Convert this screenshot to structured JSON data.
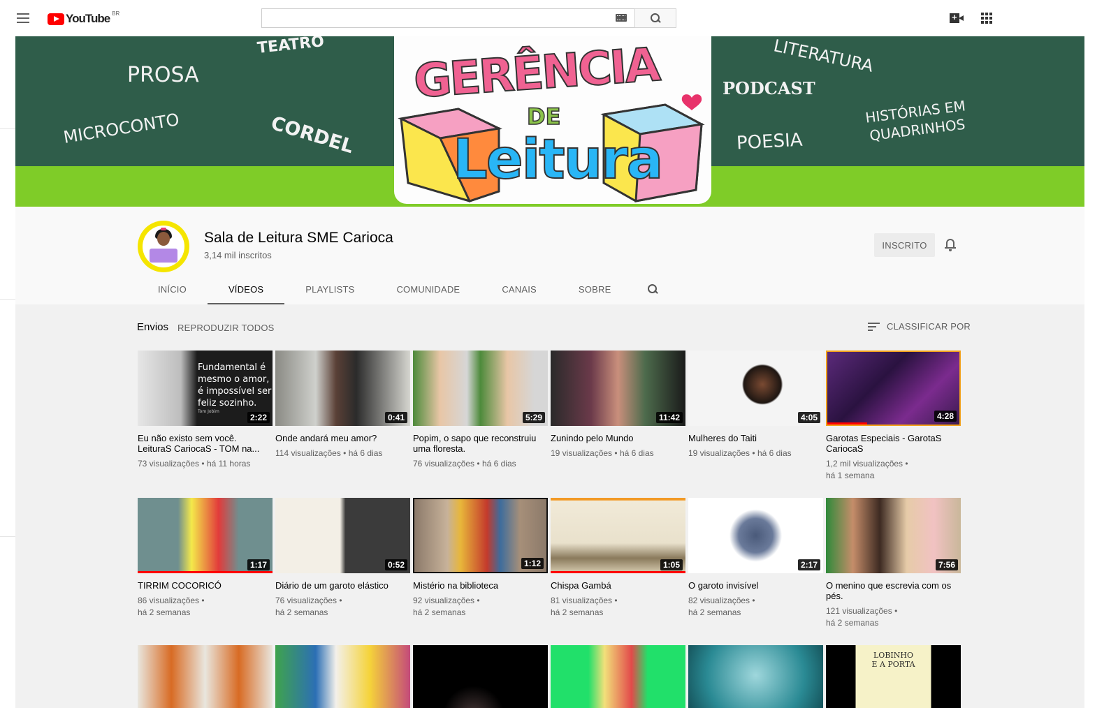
{
  "masthead": {
    "logo_text": "YouTube",
    "country": "BR",
    "search_placeholder": ""
  },
  "banner": {
    "words": [
      "TEATRO",
      "PROSA",
      "MICROCONTO",
      "CORDEL",
      "LITERATURA",
      "PODCAST",
      "POESIA",
      "HISTÓRIAS EM",
      "QUADRINHOS"
    ],
    "logo_line1": "GERÊNCIA",
    "logo_line2": "DE",
    "logo_line3": "Leitura",
    "colors": {
      "dark_green": "#2f5d4a",
      "lime": "#7fcc28"
    }
  },
  "channel": {
    "name": "Sala de Leitura SME Carioca",
    "subscribers": "3,14 mil inscritos",
    "subscribe_button": "INSCRITO",
    "tabs": [
      "INÍCIO",
      "VÍDEOS",
      "PLAYLISTS",
      "COMUNIDADE",
      "CANAIS",
      "SOBRE"
    ],
    "active_tab": "VÍDEOS"
  },
  "shelf": {
    "title": "Envios",
    "play_all": "REPRODUZIR TODOS",
    "sort": "CLASSIFICAR POR"
  },
  "thumb_captions": {
    "tom_quote": [
      "Fundamental é",
      "mesmo o amor,",
      "é impossível ser",
      "feliz sozinho."
    ],
    "tom_credit": "Tom Jobim"
  },
  "videos": [
    {
      "title": "Eu não existo sem você. LeituraS CariocaS - TOM na...",
      "views": "73 visualizações",
      "age": "há 11 horas",
      "duration": "2:22",
      "thumb": "#1c1c1c"
    },
    {
      "title": "Onde andará meu amor?",
      "views": "114 visualizações",
      "age": "há 6 dias",
      "duration": "0:41",
      "thumb": "#6d6a64"
    },
    {
      "title": "Popim, o sapo que reconstruiu uma floresta.",
      "views": "76 visualizações",
      "age": "há 6 dias",
      "duration": "5:29",
      "thumb": "#5d8c3e"
    },
    {
      "title": "Zunindo pelo Mundo",
      "views": "19 visualizações",
      "age": "há 6 dias",
      "duration": "11:42",
      "thumb": "#4a2b35"
    },
    {
      "title": "Mulheres do Taiti",
      "views": "19 visualizações",
      "age": "há 6 dias",
      "duration": "4:05",
      "thumb": "#f3f3f3"
    },
    {
      "title": "Garotas Especiais - GarotaS CariocaS",
      "views": "1,2 mil visualizações",
      "age": "há 1 semana",
      "duration": "4:28",
      "thumb": "#3a1b4f"
    },
    {
      "title": "TIRRIM COCORICÓ",
      "views": "86 visualizações",
      "age": "há 2 semanas",
      "duration": "1:17",
      "thumb": "#5a7b7c"
    },
    {
      "title": "Diário de um garoto elástico",
      "views": "76 visualizações",
      "age": "há 2 semanas",
      "duration": "0:52",
      "thumb": "#3b3b3b"
    },
    {
      "title": "Mistério na biblioteca",
      "views": "92 visualizações",
      "age": "há 2 semanas",
      "duration": "1:12",
      "thumb": "#9d8a6a"
    },
    {
      "title": "Chispa Gambá",
      "views": "81 visualizações",
      "age": "há 2 semanas",
      "duration": "1:05",
      "thumb": "#e9e3d3"
    },
    {
      "title": "O garoto invisível",
      "views": "82 visualizações",
      "age": "há 2 semanas",
      "duration": "2:17",
      "thumb": "#ffffff"
    },
    {
      "title": "O menino que escrevia com os pés.",
      "views": "121 visualizações",
      "age": "há 2 semanas",
      "duration": "7:56",
      "thumb": "#c9b79a"
    }
  ],
  "row3_books": {
    "lobinho_title_1": "LOBINHO",
    "lobinho_title_2": "E A PORTA"
  }
}
